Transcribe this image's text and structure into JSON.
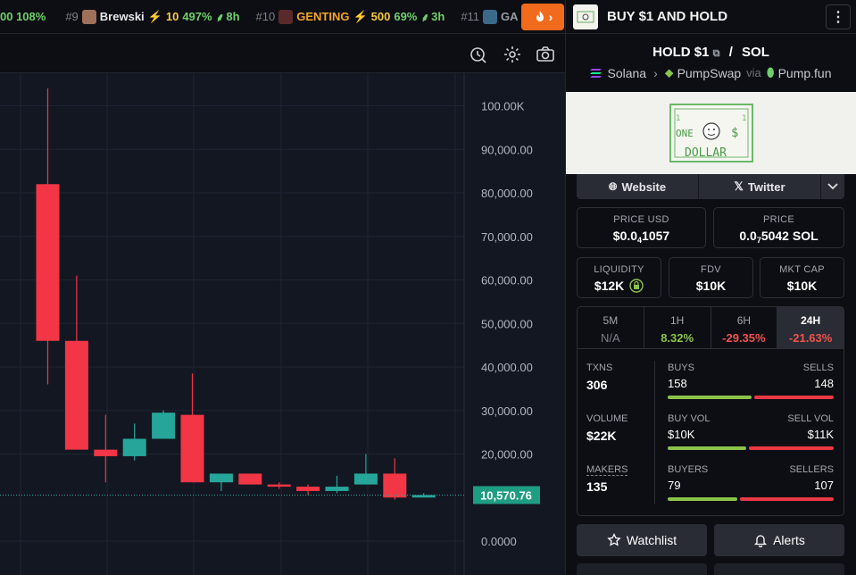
{
  "ticker": [
    {
      "rank": "",
      "name": "",
      "boost": "",
      "pct": "00 108%",
      "age": ""
    },
    {
      "rank": "#9",
      "name": "Brewski",
      "boost": "10",
      "pct": "497%",
      "age": "8h"
    },
    {
      "rank": "#10",
      "name": "GENTING",
      "boost": "500",
      "pct": "69%",
      "age": "3h"
    },
    {
      "rank": "#11",
      "name": "GA",
      "boost": "",
      "pct": "",
      "age": ""
    }
  ],
  "chart": {
    "price_labels": [
      "100.00K",
      "90,000.00",
      "80,000.00",
      "70,000.00",
      "60,000.00",
      "50,000.00",
      "40,000.00",
      "30,000.00",
      "20,000.00",
      "0.0000"
    ],
    "current_price": "10,570.76",
    "colors": {
      "up": "#26a69a",
      "down": "#f23645"
    }
  },
  "chart_data": {
    "type": "candlestick",
    "ylim": [
      0,
      100000
    ],
    "candles": [
      {
        "o": 82000,
        "h": 104000,
        "l": 36000,
        "c": 46000
      },
      {
        "o": 46000,
        "h": 61000,
        "l": 21000,
        "c": 21000
      },
      {
        "o": 21000,
        "h": 29000,
        "l": 13500,
        "c": 19500
      },
      {
        "o": 19500,
        "h": 27000,
        "l": 18500,
        "c": 23500
      },
      {
        "o": 23500,
        "h": 30000,
        "l": 23500,
        "c": 29500
      },
      {
        "o": 29000,
        "h": 38500,
        "l": 13500,
        "c": 13500
      },
      {
        "o": 13500,
        "h": 15500,
        "l": 11500,
        "c": 15500
      },
      {
        "o": 15500,
        "h": 15500,
        "l": 13000,
        "c": 13000
      },
      {
        "o": 13000,
        "h": 13500,
        "l": 12000,
        "c": 12500
      },
      {
        "o": 12500,
        "h": 13000,
        "l": 10500,
        "c": 11500
      },
      {
        "o": 11500,
        "h": 15000,
        "l": 11000,
        "c": 12500
      },
      {
        "o": 13000,
        "h": 20000,
        "l": 13000,
        "c": 15500
      },
      {
        "o": 15500,
        "h": 19000,
        "l": 9500,
        "c": 10000
      },
      {
        "o": 10000,
        "h": 11000,
        "l": 10000,
        "c": 10570.76
      }
    ]
  },
  "header": {
    "title": "BUY $1 AND HOLD"
  },
  "pair": {
    "base": "HOLD $1",
    "quote": "SOL"
  },
  "breadcrumbs": {
    "chain": "Solana",
    "dex": "PumpSwap",
    "via": "via",
    "launchpad": "Pump.fun"
  },
  "banner": {
    "text_one": "ONE",
    "text_dollar": "DOLLAR",
    "symbol": "$"
  },
  "links": {
    "website": "Website",
    "twitter": "Twitter"
  },
  "prices": {
    "usd_label": "PRICE USD",
    "usd_pre": "$0.0",
    "usd_sub": "4",
    "usd_post": "1057",
    "sol_label": "PRICE",
    "sol_pre": "0.0",
    "sol_sub": "7",
    "sol_post": "5042 SOL"
  },
  "metrics": [
    {
      "label": "LIQUIDITY",
      "value": "$12K"
    },
    {
      "label": "FDV",
      "value": "$10K"
    },
    {
      "label": "MKT CAP",
      "value": "$10K"
    }
  ],
  "timeframes": [
    {
      "label": "5M",
      "value": "N/A",
      "color": "#7d808b"
    },
    {
      "label": "1H",
      "value": "8.32%",
      "color": "#8bc34a"
    },
    {
      "label": "6H",
      "value": "-29.35%",
      "color": "#ef5350"
    },
    {
      "label": "24H",
      "value": "-21.63%",
      "color": "#ef5350"
    }
  ],
  "stats": {
    "txns_label": "TXNS",
    "txns": "306",
    "buys_label": "BUYS",
    "buys": "158",
    "sells_label": "SELLS",
    "sells": "148",
    "volume_label": "VOLUME",
    "volume": "$22K",
    "buy_vol_label": "BUY VOL",
    "buy_vol": "$10K",
    "sell_vol_label": "SELL VOL",
    "sell_vol": "$11K",
    "makers_label": "MAKERS",
    "makers": "135",
    "buyers_label": "BUYERS",
    "buyers": "79",
    "sellers_label": "SELLERS",
    "sellers": "107",
    "buys_fraction": 0.516,
    "buy_vol_fraction": 0.48,
    "buyers_fraction": 0.425
  },
  "actions": {
    "watchlist": "Watchlist",
    "alerts": "Alerts"
  }
}
